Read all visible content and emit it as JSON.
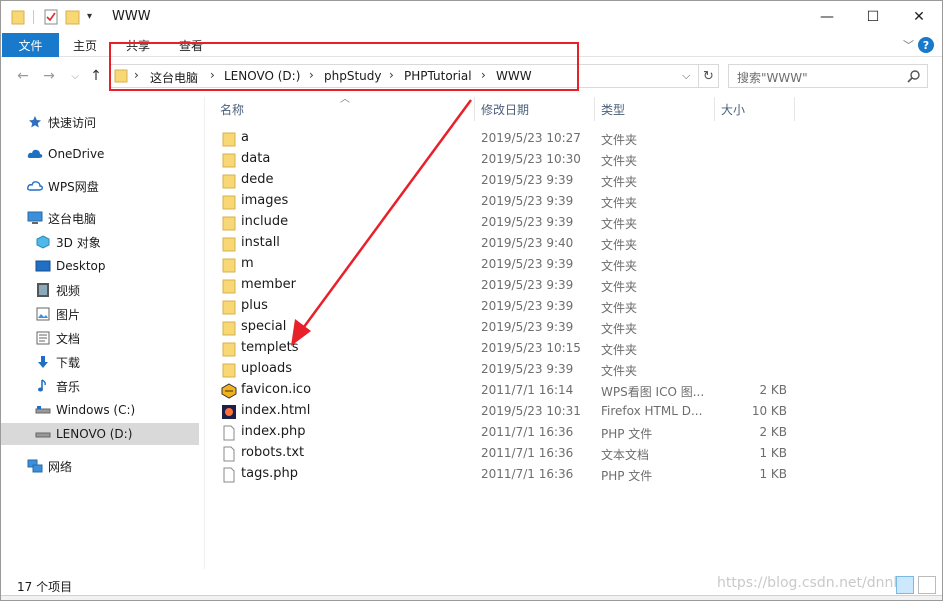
{
  "window": {
    "title": "WWW",
    "minimize_glyph": "—",
    "maximize_glyph": "☐",
    "close_glyph": "✕"
  },
  "ribbon": {
    "tabs": [
      "文件",
      "主页",
      "共享",
      "查看"
    ],
    "collapse_glyph": "﹀",
    "help_glyph": "?"
  },
  "address": {
    "breadcrumbs": [
      "这台电脑",
      "LENOVO (D:)",
      "phpStudy",
      "PHPTutorial",
      "WWW"
    ],
    "separator": "›",
    "dropdown_glyph": "⌵",
    "refresh_glyph": "↻"
  },
  "search": {
    "placeholder": "搜索\"WWW\""
  },
  "sidebar": {
    "items": [
      {
        "label": "快速访问",
        "icon": "star-icon"
      },
      {
        "label": "OneDrive",
        "icon": "cloud-icon"
      },
      {
        "label": "WPS网盘",
        "icon": "wps-cloud-icon"
      },
      {
        "label": "这台电脑",
        "icon": "computer-icon"
      },
      {
        "label": "3D 对象",
        "icon": "cube-icon"
      },
      {
        "label": "Desktop",
        "icon": "desktop-icon"
      },
      {
        "label": "视频",
        "icon": "video-icon"
      },
      {
        "label": "图片",
        "icon": "picture-icon"
      },
      {
        "label": "文档",
        "icon": "document-icon"
      },
      {
        "label": "下载",
        "icon": "download-icon"
      },
      {
        "label": "音乐",
        "icon": "music-icon"
      },
      {
        "label": "Windows (C:)",
        "icon": "drive-icon"
      },
      {
        "label": "LENOVO (D:)",
        "icon": "drive-icon"
      },
      {
        "label": "网络",
        "icon": "network-icon"
      }
    ]
  },
  "columns": {
    "name": "名称",
    "date": "修改日期",
    "type": "类型",
    "size": "大小"
  },
  "files": [
    {
      "name": "a",
      "date": "2019/5/23 10:27",
      "type": "文件夹",
      "size": "",
      "icon": "folder-icon"
    },
    {
      "name": "data",
      "date": "2019/5/23 10:30",
      "type": "文件夹",
      "size": "",
      "icon": "folder-icon"
    },
    {
      "name": "dede",
      "date": "2019/5/23 9:39",
      "type": "文件夹",
      "size": "",
      "icon": "folder-icon"
    },
    {
      "name": "images",
      "date": "2019/5/23 9:39",
      "type": "文件夹",
      "size": "",
      "icon": "folder-icon"
    },
    {
      "name": "include",
      "date": "2019/5/23 9:39",
      "type": "文件夹",
      "size": "",
      "icon": "folder-icon"
    },
    {
      "name": "install",
      "date": "2019/5/23 9:40",
      "type": "文件夹",
      "size": "",
      "icon": "folder-icon"
    },
    {
      "name": "m",
      "date": "2019/5/23 9:39",
      "type": "文件夹",
      "size": "",
      "icon": "folder-icon"
    },
    {
      "name": "member",
      "date": "2019/5/23 9:39",
      "type": "文件夹",
      "size": "",
      "icon": "folder-icon"
    },
    {
      "name": "plus",
      "date": "2019/5/23 9:39",
      "type": "文件夹",
      "size": "",
      "icon": "folder-icon"
    },
    {
      "name": "special",
      "date": "2019/5/23 9:39",
      "type": "文件夹",
      "size": "",
      "icon": "folder-icon"
    },
    {
      "name": "templets",
      "date": "2019/5/23 10:15",
      "type": "文件夹",
      "size": "",
      "icon": "folder-icon"
    },
    {
      "name": "uploads",
      "date": "2019/5/23 9:39",
      "type": "文件夹",
      "size": "",
      "icon": "folder-icon"
    },
    {
      "name": "favicon.ico",
      "date": "2011/7/1 16:14",
      "type": "WPS看图 ICO 图...",
      "size": "2 KB",
      "icon": "ico-file-icon"
    },
    {
      "name": "index.html",
      "date": "2019/5/23 10:31",
      "type": "Firefox HTML D...",
      "size": "10 KB",
      "icon": "html-file-icon"
    },
    {
      "name": "index.php",
      "date": "2011/7/1 16:36",
      "type": "PHP 文件",
      "size": "2 KB",
      "icon": "file-icon"
    },
    {
      "name": "robots.txt",
      "date": "2011/7/1 16:36",
      "type": "文本文档",
      "size": "1 KB",
      "icon": "file-icon"
    },
    {
      "name": "tags.php",
      "date": "2011/7/1 16:36",
      "type": "PHP 文件",
      "size": "1 KB",
      "icon": "file-icon"
    }
  ],
  "status": {
    "count": "17 个项目",
    "watermark": "https://blog.csdn.net/dnnb"
  },
  "colors": {
    "accent": "#1979ca",
    "folder": "#f8d775",
    "annotation": "#e8202a",
    "selected": "#d9d9d9"
  }
}
